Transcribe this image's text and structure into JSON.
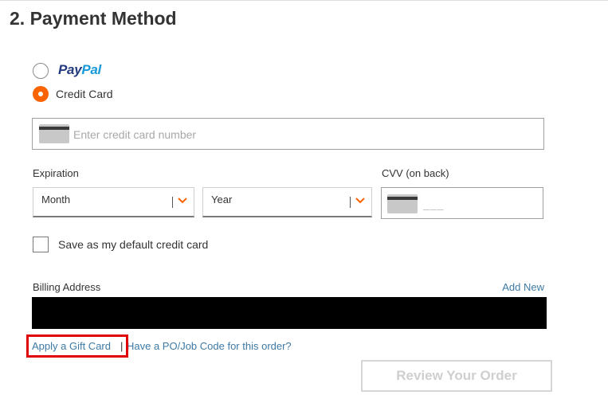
{
  "section": {
    "title": "2. Payment Method"
  },
  "payment_options": {
    "paypal": {
      "logo_pay": "Pay",
      "logo_pal": "Pal",
      "selected": false
    },
    "credit_card": {
      "label": "Credit Card",
      "selected": true
    }
  },
  "card_number": {
    "placeholder": "Enter credit card number",
    "value": ""
  },
  "expiration": {
    "label": "Expiration",
    "month": {
      "selected": "Month"
    },
    "year": {
      "selected": "Year"
    }
  },
  "cvv": {
    "label": "CVV (on back)",
    "placeholder": "___"
  },
  "save_default": {
    "label": "Save as my default credit card",
    "checked": false
  },
  "billing": {
    "label": "Billing Address",
    "add_new": "Add New"
  },
  "links": {
    "gift_card": "Apply a Gift Card",
    "separator": "|",
    "po_code": "Have a PO/Job Code for this order?"
  },
  "review_button": {
    "label": "Review Your Order",
    "enabled": false
  },
  "colors": {
    "accent_orange": "#f96302",
    "link_blue": "#3e7aa5",
    "paypal_dark": "#253b80",
    "paypal_light": "#179bd7",
    "highlight_red": "#e00000"
  },
  "icons": {
    "card": "credit-card-icon",
    "chevron": "chevron-down-icon"
  }
}
